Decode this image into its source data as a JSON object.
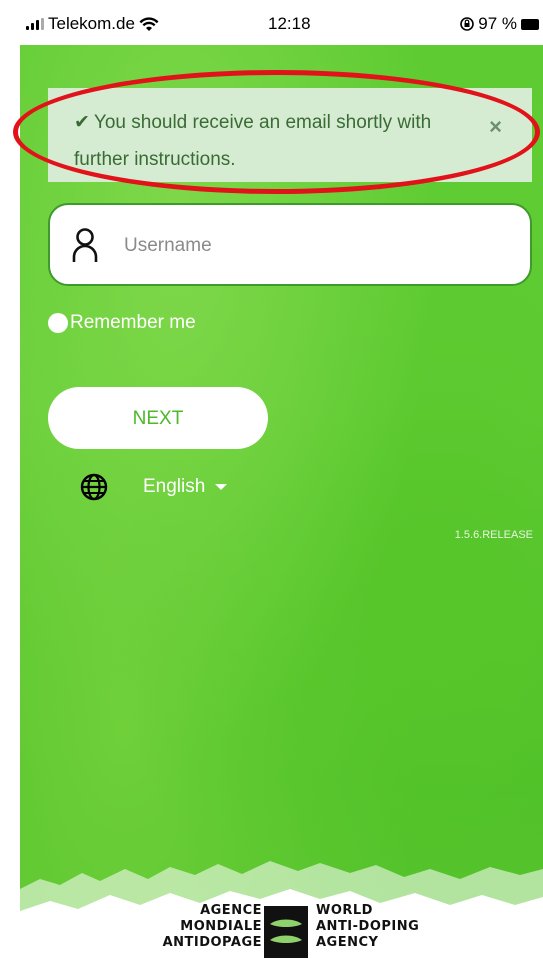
{
  "status_bar": {
    "carrier": "Telekom.de",
    "time": "12:18",
    "battery": "97 %"
  },
  "alert": {
    "check_glyph": "✔",
    "message": "You should receive an email shortly with further instructions.",
    "close_glyph": "×"
  },
  "login": {
    "username_placeholder": "Username",
    "remember_label": "Remember me",
    "next_label": "NEXT"
  },
  "language": {
    "selected": "English"
  },
  "version": "1.5.6.RELEASE",
  "logo": {
    "left_line1": "AGENCE",
    "left_line2": "MONDIALE",
    "left_line3": "ANTIDOPAGE",
    "right_line1": "WORLD",
    "right_line2": "ANTI-DOPING",
    "right_line3": "AGENCY"
  },
  "colors": {
    "brand_green": "#5ecb32",
    "alert_bg": "#d5ecd2",
    "annotation_red": "#e2121a"
  },
  "icons": [
    "signal-icon",
    "wifi-icon",
    "rotation-lock-icon",
    "battery-icon",
    "check-icon",
    "close-icon",
    "user-icon",
    "globe-icon",
    "caret-down-icon"
  ]
}
